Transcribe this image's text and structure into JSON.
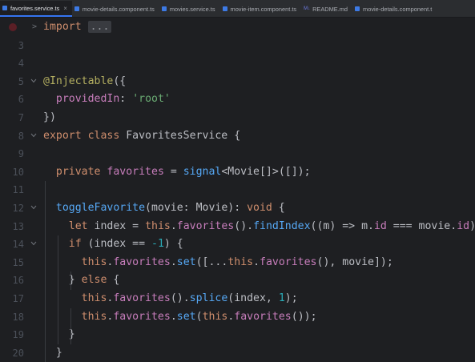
{
  "tabs": [
    {
      "label": "favorites.service.ts",
      "active": true,
      "close": "×"
    },
    {
      "label": "movie-details.component.ts",
      "active": false
    },
    {
      "label": "movies.service.ts",
      "active": false
    },
    {
      "label": "movie-item.component.ts",
      "active": false
    },
    {
      "label": "README.md",
      "active": false,
      "icon_text": "M↓"
    },
    {
      "label": "movie-details.component.t",
      "active": false
    }
  ],
  "editor": {
    "colors": {
      "background": "#1e1f22",
      "keyword": "#cf8e6d",
      "function": "#56a8f5",
      "field": "#c77dbb",
      "string": "#6aab73",
      "number": "#2aacb8",
      "annotation": "#b3ae60"
    },
    "fold_marker": ">",
    "lines": [
      {
        "num": "",
        "tokens": [
          [
            "kw",
            "import"
          ],
          [
            "plain",
            " "
          ],
          [
            "chip",
            "..."
          ]
        ]
      },
      {
        "num": "3",
        "tokens": []
      },
      {
        "num": "4",
        "tokens": []
      },
      {
        "num": "5",
        "tokens": [
          [
            "ann",
            "@Injectable"
          ],
          [
            "plain",
            "({"
          ]
        ]
      },
      {
        "num": "6",
        "tokens": [
          [
            "plain",
            "  "
          ],
          [
            "fld",
            "providedIn"
          ],
          [
            "plain",
            ": "
          ],
          [
            "str",
            "'root'"
          ]
        ]
      },
      {
        "num": "7",
        "tokens": [
          [
            "plain",
            "})"
          ]
        ]
      },
      {
        "num": "8",
        "tokens": [
          [
            "kw",
            "export class "
          ],
          [
            "plain",
            "FavoritesService {"
          ]
        ]
      },
      {
        "num": "9",
        "tokens": []
      },
      {
        "num": "10",
        "tokens": [
          [
            "plain",
            "  "
          ],
          [
            "kw",
            "private "
          ],
          [
            "fld",
            "favorites"
          ],
          [
            "plain",
            " = "
          ],
          [
            "fn",
            "signal"
          ],
          [
            "plain",
            "<Movie[]>([]);"
          ]
        ]
      },
      {
        "num": "11",
        "tokens": []
      },
      {
        "num": "12",
        "tokens": [
          [
            "plain",
            "  "
          ],
          [
            "fn",
            "toggleFavorite"
          ],
          [
            "plain",
            "(movie: Movie): "
          ],
          [
            "kw",
            "void "
          ],
          [
            "plain",
            "{"
          ]
        ]
      },
      {
        "num": "13",
        "tokens": [
          [
            "plain",
            "    "
          ],
          [
            "kw",
            "let "
          ],
          [
            "plain",
            "index = "
          ],
          [
            "kw",
            "this"
          ],
          [
            "plain",
            "."
          ],
          [
            "fld",
            "favorites"
          ],
          [
            "plain",
            "()."
          ],
          [
            "fn",
            "findIndex"
          ],
          [
            "plain",
            "((m) => m."
          ],
          [
            "fld",
            "id"
          ],
          [
            "plain",
            " === movie."
          ],
          [
            "fld",
            "id"
          ],
          [
            "plain",
            ");"
          ]
        ]
      },
      {
        "num": "14",
        "tokens": [
          [
            "plain",
            "    "
          ],
          [
            "kw",
            "if "
          ],
          [
            "plain",
            "(index == "
          ],
          [
            "num",
            "-1"
          ],
          [
            "plain",
            ") {"
          ]
        ]
      },
      {
        "num": "15",
        "tokens": [
          [
            "plain",
            "      "
          ],
          [
            "kw",
            "this"
          ],
          [
            "plain",
            "."
          ],
          [
            "fld",
            "favorites"
          ],
          [
            "plain",
            "."
          ],
          [
            "fn",
            "set"
          ],
          [
            "plain",
            "([..."
          ],
          [
            "kw",
            "this"
          ],
          [
            "plain",
            "."
          ],
          [
            "fld",
            "favorites"
          ],
          [
            "plain",
            "(), movie]);"
          ]
        ]
      },
      {
        "num": "16",
        "tokens": [
          [
            "plain",
            "    } "
          ],
          [
            "kw",
            "else "
          ],
          [
            "plain",
            "{"
          ]
        ]
      },
      {
        "num": "17",
        "tokens": [
          [
            "plain",
            "      "
          ],
          [
            "kw",
            "this"
          ],
          [
            "plain",
            "."
          ],
          [
            "fld",
            "favorites"
          ],
          [
            "plain",
            "()."
          ],
          [
            "fn",
            "splice"
          ],
          [
            "plain",
            "(index, "
          ],
          [
            "num",
            "1"
          ],
          [
            "plain",
            ");"
          ]
        ]
      },
      {
        "num": "18",
        "tokens": [
          [
            "plain",
            "      "
          ],
          [
            "kw",
            "this"
          ],
          [
            "plain",
            "."
          ],
          [
            "fld",
            "favorites"
          ],
          [
            "plain",
            "."
          ],
          [
            "fn",
            "set"
          ],
          [
            "plain",
            "("
          ],
          [
            "kw",
            "this"
          ],
          [
            "plain",
            "."
          ],
          [
            "fld",
            "favorites"
          ],
          [
            "plain",
            "());"
          ]
        ]
      },
      {
        "num": "19",
        "tokens": [
          [
            "plain",
            "    }"
          ]
        ]
      },
      {
        "num": "20",
        "tokens": [
          [
            "plain",
            "  }"
          ]
        ]
      }
    ]
  }
}
